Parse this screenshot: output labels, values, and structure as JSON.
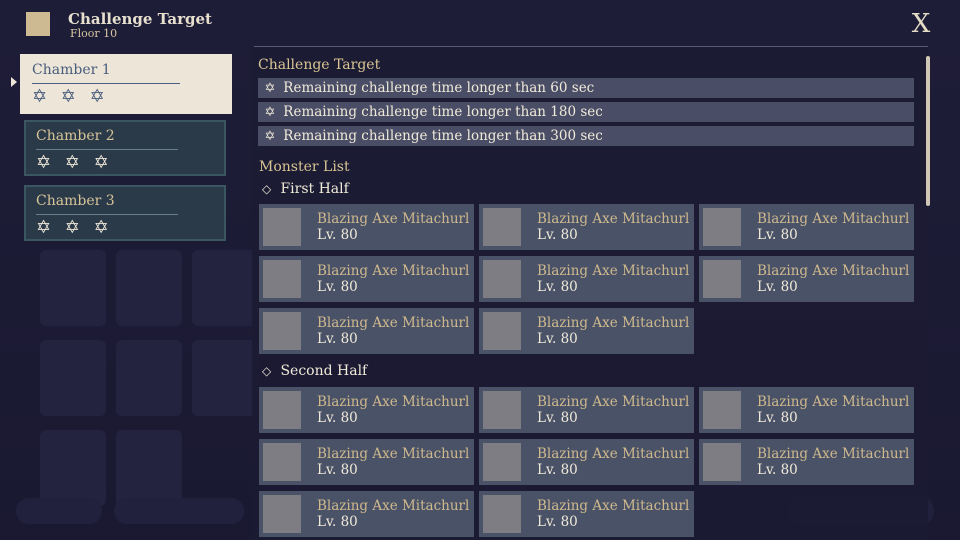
{
  "header": {
    "title": "Challenge Target",
    "floor": "Floor 10",
    "close_label": "X"
  },
  "chambers": [
    {
      "label": "Chamber 1",
      "stars": "✡ ✡ ✡",
      "selected": true
    },
    {
      "label": "Chamber 2",
      "stars": "✡ ✡ ✡",
      "selected": false
    },
    {
      "label": "Chamber 3",
      "stars": "✡ ✡ ✡",
      "selected": false
    }
  ],
  "panel": {
    "challenge_title": "Challenge Target",
    "targets": [
      {
        "icon": "✡",
        "text": "Remaining challenge time longer than 60 sec"
      },
      {
        "icon": "✡",
        "text": "Remaining challenge time longer than 180 sec"
      },
      {
        "icon": "✡",
        "text": "Remaining challenge time longer than 300 sec"
      }
    ],
    "monster_title": "Monster List",
    "first_half": {
      "label": "First Half",
      "icon": "◇",
      "monsters": [
        {
          "name": "Blazing Axe Mitachurl",
          "level": "Lv. 80"
        },
        {
          "name": "Blazing Axe Mitachurl",
          "level": "Lv. 80"
        },
        {
          "name": "Blazing Axe Mitachurl",
          "level": "Lv. 80"
        },
        {
          "name": "Blazing Axe Mitachurl",
          "level": "Lv. 80"
        },
        {
          "name": "Blazing Axe Mitachurl",
          "level": "Lv. 80"
        },
        {
          "name": "Blazing Axe Mitachurl",
          "level": "Lv. 80"
        },
        {
          "name": "Blazing Axe Mitachurl",
          "level": "Lv. 80"
        },
        {
          "name": "Blazing Axe Mitachurl",
          "level": "Lv. 80"
        }
      ]
    },
    "second_half": {
      "label": "Second Half",
      "icon": "◇",
      "monsters": [
        {
          "name": "Blazing Axe Mitachurl",
          "level": "Lv. 80"
        },
        {
          "name": "Blazing Axe Mitachurl",
          "level": "Lv. 80"
        },
        {
          "name": "Blazing Axe Mitachurl",
          "level": "Lv. 80"
        },
        {
          "name": "Blazing Axe Mitachurl",
          "level": "Lv. 80"
        },
        {
          "name": "Blazing Axe Mitachurl",
          "level": "Lv. 80"
        },
        {
          "name": "Blazing Axe Mitachurl",
          "level": "Lv. 80"
        },
        {
          "name": "Blazing Axe Mitachurl",
          "level": "Lv. 80"
        },
        {
          "name": "Blazing Axe Mitachurl",
          "level": "Lv. 80"
        }
      ]
    }
  },
  "colors": {
    "background": "#1b1a33",
    "accent_gold": "#d9c593",
    "card_bg": "#4a5268",
    "selected_chamber": "#ece5d8"
  }
}
